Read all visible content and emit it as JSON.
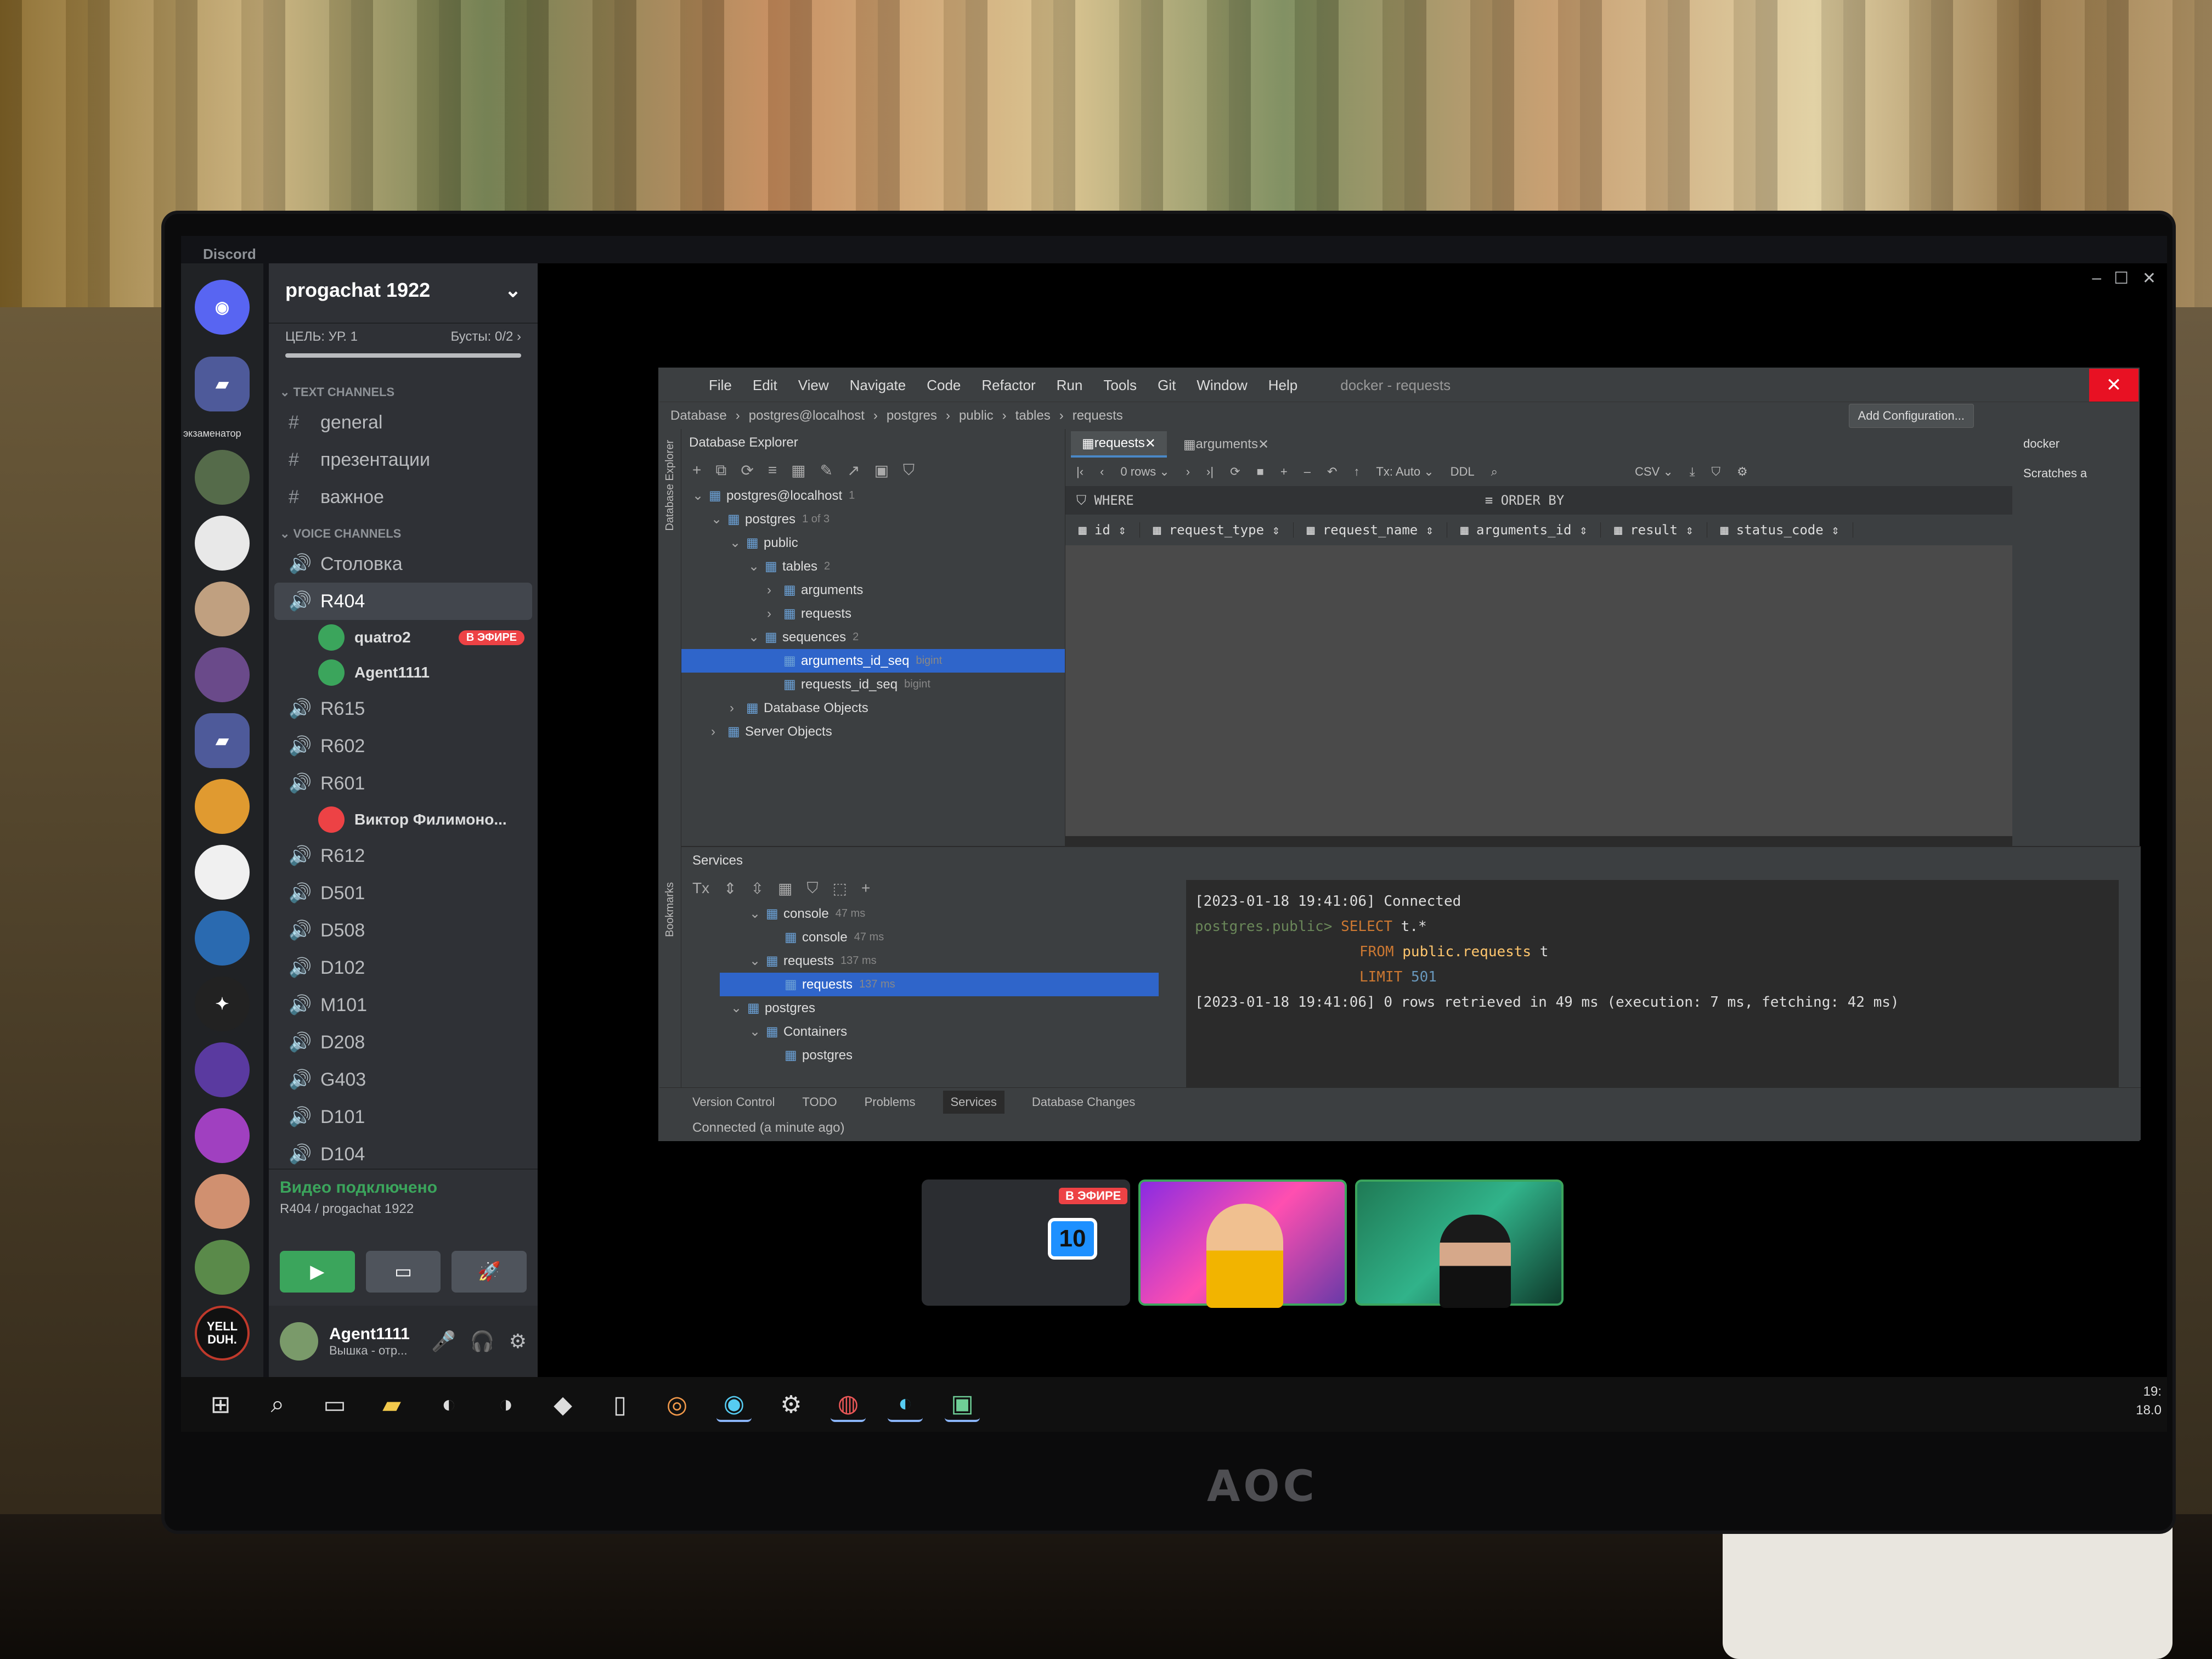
{
  "monitor": {
    "brand": "AOC"
  },
  "discord": {
    "app_title": "Discord",
    "server": {
      "name": "progachat 1922",
      "boost_goal": "ЦЕЛЬ: УР. 1",
      "boosts": "Бусты: 0/2 ›"
    },
    "rail_label": "экзаменатор",
    "categories": {
      "text": "TEXT CHANNELS",
      "voice": "VOICE CHANNELS"
    },
    "text_channels": [
      "general",
      "презентации",
      "важное"
    ],
    "voice_channels_top": [
      "Столовка",
      "R404"
    ],
    "r404_users": [
      {
        "name": "quatro2",
        "badge": "В ЭФИРЕ"
      },
      {
        "name": "Agent1111",
        "badge": ""
      }
    ],
    "voice_channels_mid": [
      "R615",
      "R602",
      "R601"
    ],
    "r601_user": "Виктор Филимоно...",
    "voice_channels_bottom": [
      "R612",
      "D501",
      "D508",
      "D102",
      "M101",
      "D208",
      "G403",
      "D101",
      "D104"
    ],
    "voice_status": {
      "title": "Видео подключено",
      "subtitle": "R404 / progachat 1922"
    },
    "user": {
      "name": "Agent1111",
      "status": "Вышка - отр..."
    },
    "stage_live_badge": "В ЭФИРЕ",
    "stream_tile_number": "10",
    "server_badge_text": "YELL DUH."
  },
  "ide": {
    "menu": [
      "File",
      "Edit",
      "View",
      "Navigate",
      "Code",
      "Refactor",
      "Run",
      "Tools",
      "Git",
      "Window",
      "Help"
    ],
    "window_title": "docker - requests",
    "breadcrumbs": [
      "Database",
      "postgres@localhost",
      "postgres",
      "public",
      "tables",
      "requests"
    ],
    "add_configuration": "Add Configuration...",
    "side_label": "Database Explorer",
    "bookmarks_label": "Bookmarks",
    "db_explorer": {
      "title": "Database Explorer",
      "tree": [
        {
          "label": "postgres@localhost",
          "hint": "1",
          "level": 0,
          "arrow": "⌄",
          "sel": false
        },
        {
          "label": "postgres",
          "hint": "1 of 3",
          "level": 1,
          "arrow": "⌄",
          "sel": false
        },
        {
          "label": "public",
          "hint": "",
          "level": 2,
          "arrow": "⌄",
          "sel": false
        },
        {
          "label": "tables",
          "hint": "2",
          "level": 3,
          "arrow": "⌄",
          "sel": false
        },
        {
          "label": "arguments",
          "hint": "",
          "level": 4,
          "arrow": "›",
          "sel": false
        },
        {
          "label": "requests",
          "hint": "",
          "level": 4,
          "arrow": "›",
          "sel": false
        },
        {
          "label": "sequences",
          "hint": "2",
          "level": 3,
          "arrow": "⌄",
          "sel": false
        },
        {
          "label": "arguments_id_seq",
          "hint": "bigint",
          "level": 4,
          "arrow": "",
          "sel": true
        },
        {
          "label": "requests_id_seq",
          "hint": "bigint",
          "level": 4,
          "arrow": "",
          "sel": false
        },
        {
          "label": "Database Objects",
          "hint": "",
          "level": 2,
          "arrow": "›",
          "sel": false
        },
        {
          "label": "Server Objects",
          "hint": "",
          "level": 1,
          "arrow": "›",
          "sel": false
        }
      ]
    },
    "editor_tabs": [
      {
        "label": "requests",
        "active": true
      },
      {
        "label": "arguments",
        "active": false
      }
    ],
    "grid_toolbar": {
      "rows": "0 rows ⌄",
      "tx": "Tx: Auto ⌄",
      "ddl": "DDL",
      "export": "CSV ⌄"
    },
    "filter": {
      "where": "WHERE",
      "order_by": "ORDER BY"
    },
    "columns": [
      "id",
      "request_type",
      "request_name",
      "arguments_id",
      "result",
      "status_code"
    ],
    "right_panel": {
      "items": [
        "docker",
        "Scratches a"
      ]
    },
    "services": {
      "title": "Services",
      "tree": [
        {
          "label": "console",
          "hint": "47 ms",
          "level": 1,
          "arrow": "⌄",
          "sel": false
        },
        {
          "label": "console",
          "hint": "47 ms",
          "level": 2,
          "arrow": "",
          "sel": false
        },
        {
          "label": "requests",
          "hint": "137 ms",
          "level": 1,
          "arrow": "⌄",
          "sel": false
        },
        {
          "label": "requests",
          "hint": "137 ms",
          "level": 2,
          "arrow": "",
          "sel": true
        },
        {
          "label": "postgres",
          "hint": "",
          "level": 0,
          "arrow": "⌄",
          "sel": false
        },
        {
          "label": "Containers",
          "hint": "",
          "level": 1,
          "arrow": "⌄",
          "sel": false
        },
        {
          "label": "postgres",
          "hint": "",
          "level": 2,
          "arrow": "",
          "sel": false
        }
      ]
    },
    "console": {
      "line1": "[2023-01-18 19:41:06] Connected",
      "prompt": "postgres.public>",
      "select": "SELECT",
      "select_rest": " t.*",
      "from": "FROM",
      "from_table": "public.requests",
      "from_alias": " t",
      "limit": "LIMIT",
      "limit_val": "501",
      "line5": "[2023-01-18 19:41:06] 0 rows retrieved in 49 ms (execution: 7 ms, fetching: 42 ms)"
    },
    "bottom_tabs": [
      "Version Control",
      "TODO",
      "Problems",
      "Services",
      "Database Changes"
    ],
    "status": "Connected (a minute ago)"
  },
  "taskbar": {
    "clock_time": "19:",
    "clock_date": "18.0"
  }
}
